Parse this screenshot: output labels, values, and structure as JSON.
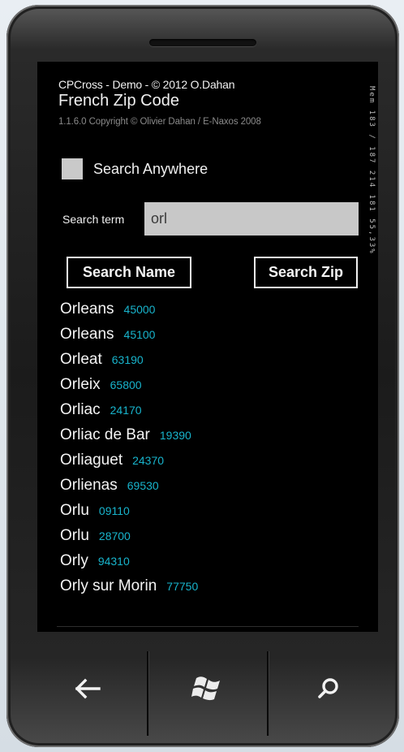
{
  "app": {
    "title": "CPCross - Demo - © 2012 O.Dahan",
    "page_title": "French Zip Code",
    "copyright": "1.1.6.0 Copyright © Olivier Dahan / E-Naxos 2008"
  },
  "system_tray": {
    "text": "Mem 183 / 187 214 181 55,33%"
  },
  "options": {
    "search_anywhere_label": "Search Anywhere",
    "search_anywhere_checked": false
  },
  "search": {
    "label": "Search term",
    "value": "orl"
  },
  "buttons": {
    "search_name": "Search Name",
    "search_zip": "Search Zip"
  },
  "results": [
    {
      "city": "Orleans",
      "zip": "45000"
    },
    {
      "city": "Orleans",
      "zip": "45100"
    },
    {
      "city": "Orleat",
      "zip": "63190"
    },
    {
      "city": "Orleix",
      "zip": "65800"
    },
    {
      "city": "Orliac",
      "zip": "24170"
    },
    {
      "city": "Orliac de Bar",
      "zip": "19390"
    },
    {
      "city": "Orliaguet",
      "zip": "24370"
    },
    {
      "city": "Orlienas",
      "zip": "69530"
    },
    {
      "city": "Orlu",
      "zip": "09110"
    },
    {
      "city": "Orlu",
      "zip": "28700"
    },
    {
      "city": "Orly",
      "zip": "94310"
    },
    {
      "city": "Orly sur Morin",
      "zip": "77750"
    }
  ],
  "hardware_buttons": {
    "back": "back-arrow-icon",
    "start": "windows-logo-icon",
    "search": "search-icon"
  },
  "colors": {
    "zip_accent": "#18b4cc",
    "background": "#000000",
    "input_background": "#c8c8c8"
  }
}
